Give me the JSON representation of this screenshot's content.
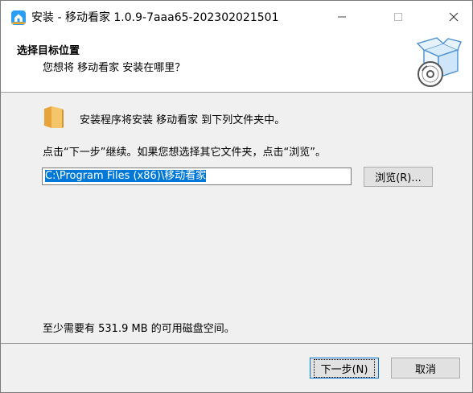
{
  "window": {
    "title": "安装 - 移动看家 1.0.9-7aaa65-202302021501",
    "app_icon": "mobile-home-app-icon",
    "controls": [
      "minimize-icon",
      "maximize-icon",
      "close-icon"
    ]
  },
  "header": {
    "title": "选择目标位置",
    "subtitle": "您想将 移动看家 安装在哪里？",
    "icon": "setup-box-disc-icon"
  },
  "body": {
    "info_text": "安装程序将安装 移动看家 到下列文件夹中。",
    "instruction": "点击“下一步”继续。如果您想选择其它文件夹，点击“浏览”。",
    "path_value": "C:\\Program Files (x86)\\移动看家",
    "browse_label": "浏览(R)...",
    "space_text": "至少需要有 531.9 MB 的可用磁盘空间。"
  },
  "footer": {
    "next_label": "下一步(N)",
    "cancel_label": "取消"
  },
  "colors": {
    "selection": "#0078d7",
    "focus_border": "#0078d7",
    "folder": "#f5c56a"
  }
}
